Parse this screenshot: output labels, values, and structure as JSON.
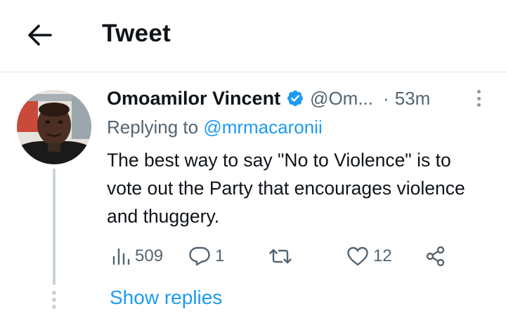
{
  "header": {
    "title": "Tweet"
  },
  "tweet": {
    "display_name": "Omoamilor Vincent",
    "handle": "@Om...",
    "separator": "·",
    "timestamp": "53m",
    "replying_prefix": "Replying to ",
    "replying_to": "@mrmacaronii",
    "text": "The best way to say \"No to Violence\" is to vote out the Party that encourages violence and thuggery.",
    "stats": {
      "views": "509",
      "replies": "1",
      "retweets": "",
      "likes": "12"
    }
  },
  "show_replies_label": "Show replies",
  "colors": {
    "accent": "#1d9bf0",
    "muted": "#536471",
    "text": "#0f1419",
    "border": "#dfe3e6",
    "thread": "#c9d3db"
  },
  "icons": [
    "back-arrow-icon",
    "verified-badge-icon",
    "more-options-icon",
    "views-icon",
    "reply-icon",
    "retweet-icon",
    "like-icon",
    "share-icon"
  ]
}
